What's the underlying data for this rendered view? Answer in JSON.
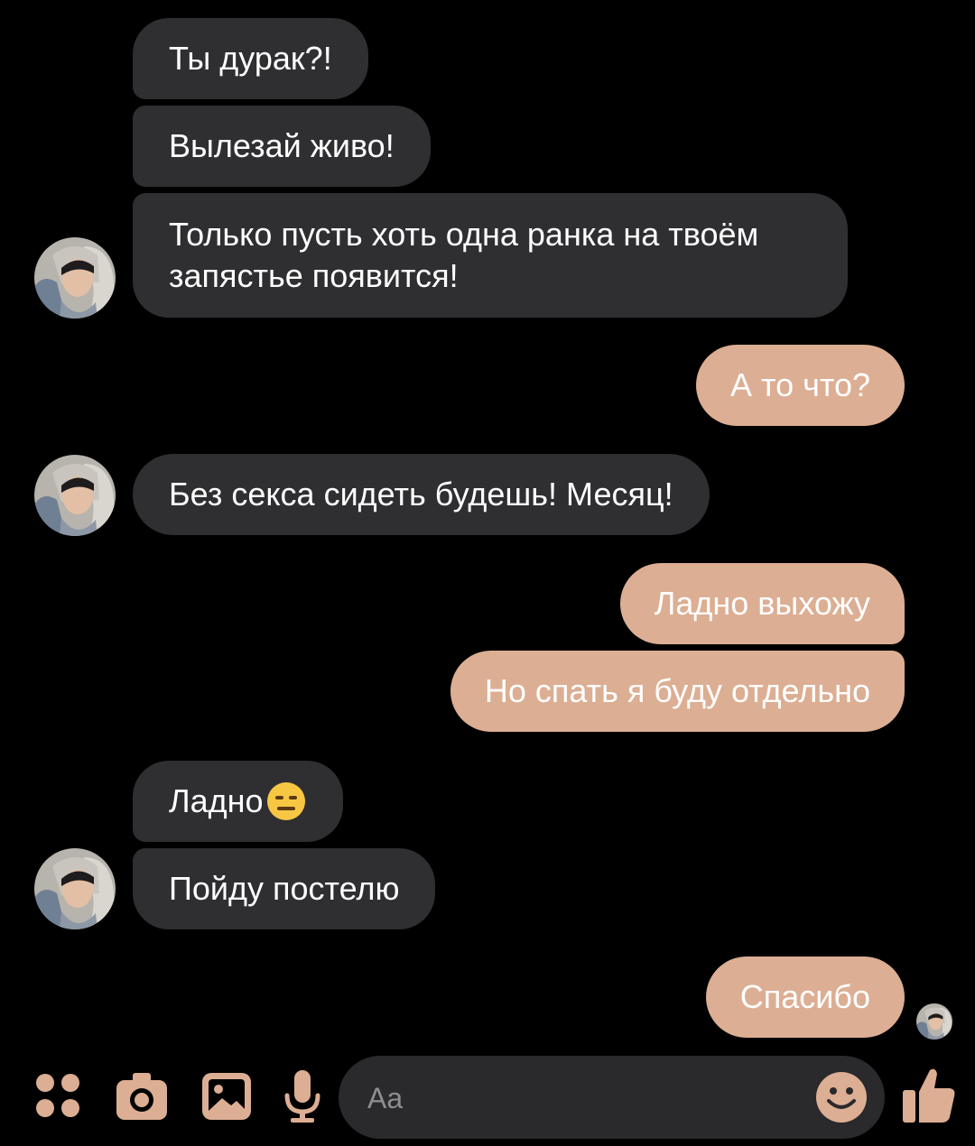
{
  "messages": [
    {
      "side": "incoming",
      "text": "Ты дурак?!"
    },
    {
      "side": "incoming",
      "text": "Вылезай живо!"
    },
    {
      "side": "incoming",
      "text": "Только пусть хоть одна ранка на твоём запястье появится!"
    },
    {
      "side": "outgoing",
      "text": "А то что?"
    },
    {
      "side": "incoming",
      "text": "Без секса сидеть будешь! Месяц!"
    },
    {
      "side": "outgoing",
      "text": "Ладно выхожу"
    },
    {
      "side": "outgoing",
      "text": "Но спать я буду отдельно"
    },
    {
      "side": "incoming",
      "text": "Ладно",
      "emoji": "expressionless-face-emoji"
    },
    {
      "side": "incoming",
      "text": "Пойду постелю"
    },
    {
      "side": "outgoing",
      "text": "Спасибо"
    }
  ],
  "composer": {
    "placeholder": "Aa"
  },
  "toolbar": {
    "icons": [
      "apps-grid-icon",
      "camera-icon",
      "gallery-icon",
      "microphone-icon",
      "emoji-icon",
      "thumbs-up-icon"
    ]
  },
  "colors": {
    "background": "#000000",
    "incoming_bubble": "#2f2e31",
    "outgoing_bubble": "#dcae93",
    "accent": "#dcae93",
    "composer_bg": "#2a292c"
  }
}
